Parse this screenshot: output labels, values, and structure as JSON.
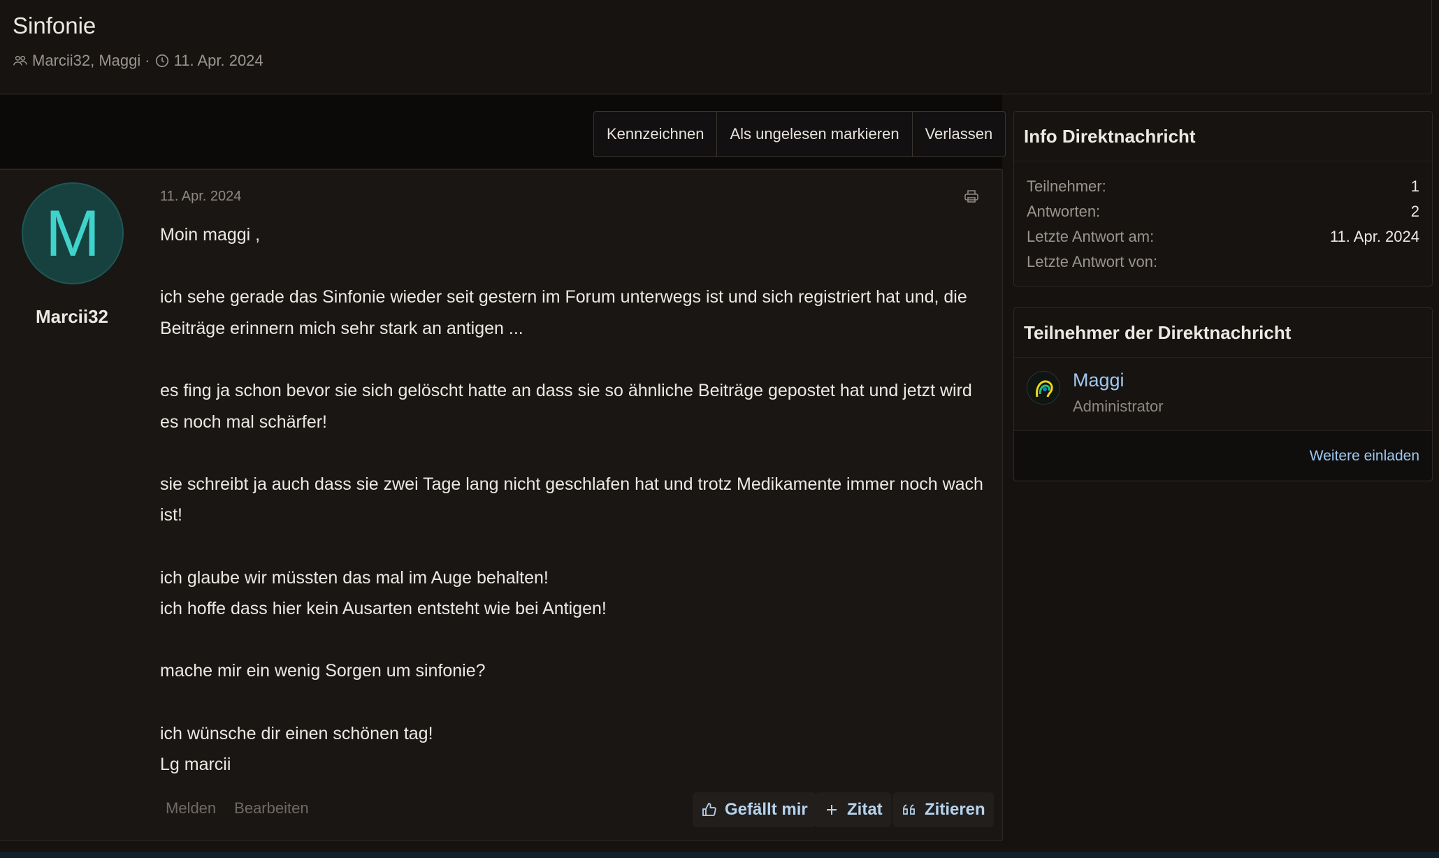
{
  "conversation": {
    "title": "Sinfonie",
    "participants": "Marcii32, Maggi",
    "separator": "·",
    "date": "11. Apr. 2024"
  },
  "actions": {
    "flag": "Kennzeichnen",
    "mark_unread": "Als ungelesen markieren",
    "leave": "Verlassen"
  },
  "post": {
    "avatar_letter": "M",
    "author": "Marcii32",
    "date": "11. Apr. 2024",
    "lines": [
      "Moin maggi ,",
      "",
      "ich sehe gerade das Sinfonie wieder seit gestern im Forum unterwegs ist und sich registriert hat und, die Beiträge erinnern mich sehr stark an antigen ...",
      "",
      "es fing ja schon bevor sie sich gelöscht hatte an dass sie so ähnliche Beiträge gepostet hat und jetzt wird es noch mal schärfer!",
      "",
      "sie schreibt ja auch dass sie zwei Tage lang nicht geschlafen hat und trotz Medikamente immer noch wach ist!",
      "",
      "ich glaube wir müssten das mal im Auge behalten!",
      "ich hoffe dass hier kein Ausarten entsteht wie bei Antigen!",
      "",
      "mache mir ein wenig Sorgen um sinfonie?",
      "",
      "ich wünsche dir einen schönen tag!",
      "Lg marcii"
    ],
    "report": "Melden",
    "edit": "Bearbeiten",
    "like": "Gefällt mir",
    "quote_plus": "Zitat",
    "quote": "Zitieren"
  },
  "info": {
    "title": "Info Direktnachricht",
    "stats": [
      {
        "label": "Teilnehmer:",
        "value": "1"
      },
      {
        "label": "Antworten:",
        "value": "2"
      },
      {
        "label": "Letzte Antwort am:",
        "value": "11. Apr. 2024"
      },
      {
        "label": "Letzte Antwort von:",
        "value": ""
      }
    ]
  },
  "participants_box": {
    "title": "Teilnehmer der Direktnachricht",
    "member": {
      "name": "Maggi",
      "role": "Administrator"
    },
    "invite": "Weitere einladen"
  },
  "colors": {
    "background": "#151210",
    "link": "#9fc8ef",
    "avatar_bg": "#17413f",
    "avatar_letter": "#3fd3cb"
  }
}
